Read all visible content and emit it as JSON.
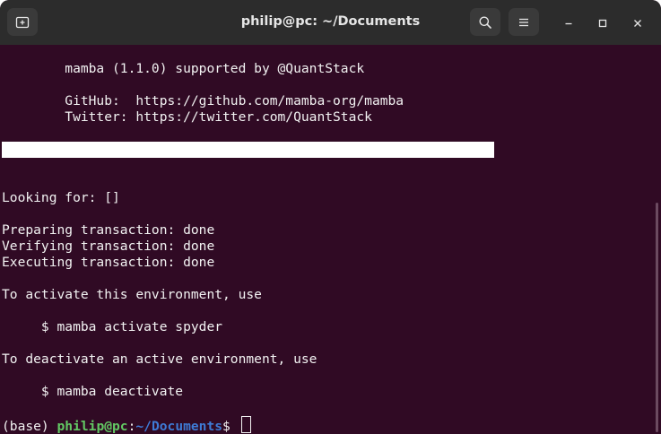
{
  "window": {
    "title": "philip@pc: ~/Documents"
  },
  "titlebar": {
    "new_tab_icon": "new-tab-icon",
    "search_icon": "search-icon",
    "menu_icon": "hamburger-menu-icon",
    "minimize_icon": "minimize-icon",
    "maximize_icon": "maximize-icon",
    "close_icon": "close-icon"
  },
  "terminal": {
    "background": "#300a24",
    "lines": [
      "        mamba (1.1.0) supported by @QuantStack",
      "",
      "        GitHub:  https://github.com/mamba-org/mamba",
      "        Twitter: https://twitter.com/QuantStack",
      "",
      "",
      "",
      "",
      "Looking for: []",
      "",
      "Preparing transaction: done",
      "Verifying transaction: done",
      "Executing transaction: done",
      "",
      "To activate this environment, use",
      "",
      "     $ mamba activate spyder",
      "",
      "To deactivate an active environment, use",
      "",
      "     $ mamba deactivate",
      ""
    ],
    "prompt": {
      "env": "(base) ",
      "user_host": "philip@pc",
      "colon": ":",
      "path": "~/Documents",
      "symbol": "$ "
    }
  }
}
